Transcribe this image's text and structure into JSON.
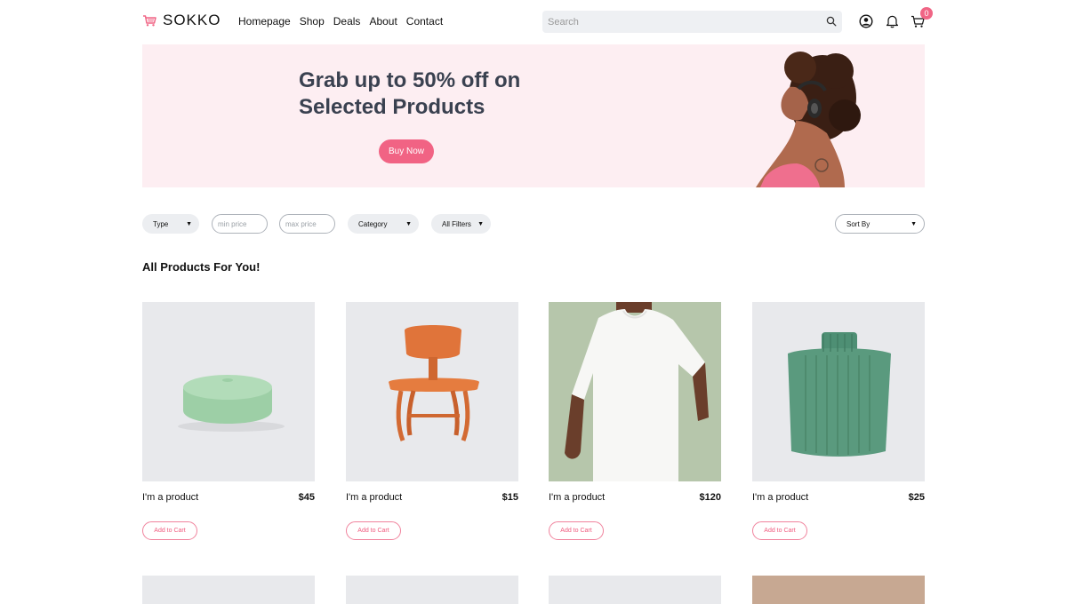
{
  "brand": {
    "name": "SOKKO",
    "icon": "shopping-cart-logo-icon",
    "accent": "#f06585"
  },
  "nav": [
    {
      "label": "Homepage"
    },
    {
      "label": "Shop"
    },
    {
      "label": "Deals"
    },
    {
      "label": "About"
    },
    {
      "label": "Contact"
    }
  ],
  "search": {
    "placeholder": "Search",
    "value": "",
    "icon": "search-icon"
  },
  "header_icons": {
    "account": "user-circle-icon",
    "notifications": "bell-icon",
    "cart": "cart-icon",
    "cart_count": "0"
  },
  "hero": {
    "title": "Grab up to 50% off on Selected Products",
    "button": "Buy Now",
    "background": "#fdeef2",
    "image": "woman-with-headphones-image"
  },
  "filters": {
    "type": "Type",
    "min_price_placeholder": "min price",
    "max_price_placeholder": "max price",
    "category": "Category",
    "all_filters": "All Filters",
    "sort": "Sort By"
  },
  "section_title": "All Products For You!",
  "products": [
    {
      "name": "I'm a product",
      "price": "$45",
      "cta": "Add to Cart",
      "image": "green-ottoman-image"
    },
    {
      "name": "I'm a product",
      "price": "$15",
      "cta": "Add to Cart",
      "image": "wooden-chair-image"
    },
    {
      "name": "I'm a product",
      "price": "$120",
      "cta": "Add to Cart",
      "image": "white-tshirt-image"
    },
    {
      "name": "I'm a product",
      "price": "$25",
      "cta": "Add to Cart",
      "image": "green-sweater-image"
    }
  ]
}
